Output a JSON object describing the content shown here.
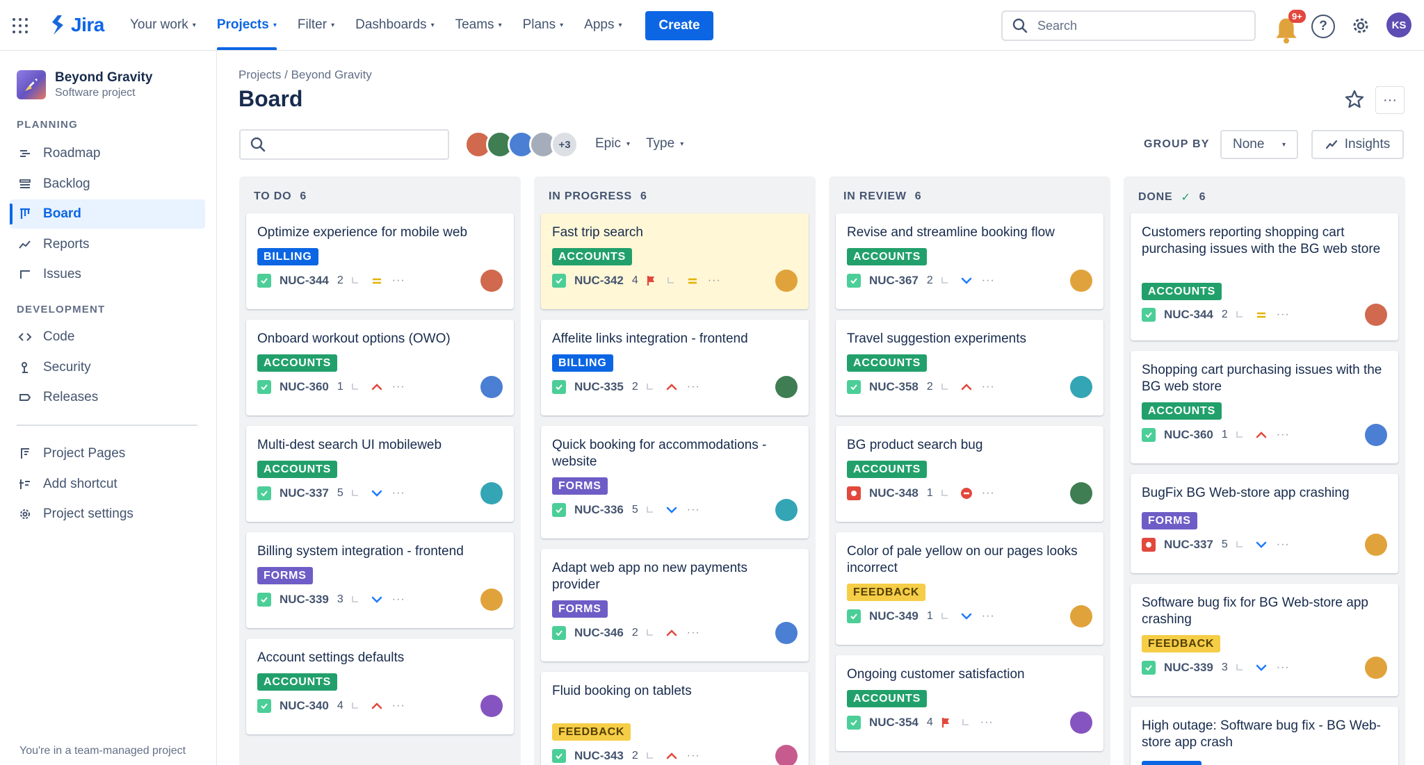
{
  "nav": {
    "logo": "Jira",
    "items": [
      {
        "label": "Your work"
      },
      {
        "label": "Projects",
        "active": true
      },
      {
        "label": "Filter"
      },
      {
        "label": "Dashboards"
      },
      {
        "label": "Teams"
      },
      {
        "label": "Plans"
      },
      {
        "label": "Apps"
      }
    ],
    "create": "Create",
    "search_placeholder": "Search",
    "notifications": "9+",
    "help": "?",
    "user_initials": "KS"
  },
  "sidebar": {
    "project_name": "Beyond Gravity",
    "project_type": "Software project",
    "planning_title": "PLANNING",
    "planning": [
      {
        "label": "Roadmap",
        "icon": "roadmap-icon"
      },
      {
        "label": "Backlog",
        "icon": "backlog-icon"
      },
      {
        "label": "Board",
        "icon": "board-icon",
        "active": true
      },
      {
        "label": "Reports",
        "icon": "reports-icon"
      },
      {
        "label": "Issues",
        "icon": "issues-icon"
      }
    ],
    "development_title": "DEVELOPMENT",
    "development": [
      {
        "label": "Code",
        "icon": "code-icon"
      },
      {
        "label": "Security",
        "icon": "security-icon"
      },
      {
        "label": "Releases",
        "icon": "releases-icon"
      }
    ],
    "extra": [
      {
        "label": "Project Pages",
        "icon": "pages-icon"
      },
      {
        "label": "Add shortcut",
        "icon": "add-shortcut-icon"
      },
      {
        "label": "Project settings",
        "icon": "settings-icon"
      }
    ],
    "footer": "You're in a team-managed project"
  },
  "header": {
    "breadcrumb": "Projects / Beyond Gravity",
    "title": "Board",
    "more": "···"
  },
  "toolbar": {
    "avatars_more": "+3",
    "epic": "Epic",
    "type": "Type",
    "group_by_label": "GROUP BY",
    "group_by_value": "None",
    "insights": "Insights"
  },
  "colors": {
    "accent": "#0c66e4",
    "accounts": "#22a06b",
    "billing": "#0c66e4",
    "forms": "#6e5dc6",
    "feedback": "#f5cd47"
  },
  "columns": [
    {
      "title": "TO DO",
      "count": "6",
      "cards": [
        {
          "title": "Optimize experience for mobile web",
          "label": "BILLING",
          "key": "NUC-344",
          "points": "2",
          "priority": "medium",
          "avatar": "#d0694d"
        },
        {
          "title": "Onboard workout options (OWO)",
          "label": "ACCOUNTS",
          "key": "NUC-360",
          "points": "1",
          "priority": "high",
          "avatar": "#4a7fd4"
        },
        {
          "title": "Multi-dest search UI mobileweb",
          "label": "ACCOUNTS",
          "key": "NUC-337",
          "points": "5",
          "priority": "low",
          "avatar": "#33a5b5"
        },
        {
          "title": "Billing system integration - frontend",
          "label": "FORMS",
          "key": "NUC-339",
          "points": "3",
          "priority": "low",
          "avatar": "#e0a33b"
        },
        {
          "title": "Account settings defaults",
          "label": "ACCOUNTS",
          "key": "NUC-340",
          "points": "4",
          "priority": "high",
          "avatar": "#8654c0"
        }
      ]
    },
    {
      "title": "IN PROGRESS",
      "count": "6",
      "cards": [
        {
          "title": "Fast trip search",
          "label": "ACCOUNTS",
          "key": "NUC-342",
          "points": "4",
          "priority": "medium",
          "flag": true,
          "highlight": true,
          "avatar": "#e0a33b"
        },
        {
          "title": "Affelite links integration - frontend",
          "label": "BILLING",
          "key": "NUC-335",
          "points": "2",
          "priority": "high",
          "avatar": "#3f7d52"
        },
        {
          "title": "Quick booking for accommodations - website",
          "label": "FORMS",
          "key": "NUC-336",
          "points": "5",
          "priority": "low",
          "avatar": "#33a5b5"
        },
        {
          "title": "Adapt web app no new payments provider",
          "label": "FORMS",
          "key": "NUC-346",
          "points": "2",
          "priority": "high",
          "avatar": "#4a7fd4"
        },
        {
          "title": "Fluid booking on tablets",
          "label": "FEEDBACK",
          "key": "NUC-343",
          "points": "2",
          "priority": "high",
          "avatar": "#c85b8e"
        }
      ]
    },
    {
      "title": "IN REVIEW",
      "count": "6",
      "cards": [
        {
          "title": "Revise and streamline booking flow",
          "label": "ACCOUNTS",
          "key": "NUC-367",
          "points": "2",
          "priority": "low",
          "avatar": "#e0a33b"
        },
        {
          "title": "Travel suggestion experiments",
          "label": "ACCOUNTS",
          "key": "NUC-358",
          "points": "2",
          "priority": "high",
          "avatar": "#33a5b5"
        },
        {
          "title": "BG product search bug",
          "label": "ACCOUNTS",
          "key": "NUC-348",
          "points": "1",
          "priority": "blocker",
          "bug": true,
          "avatar": "#3f7d52"
        },
        {
          "title": "Color of pale yellow on our pages looks incorrect",
          "label": "FEEDBACK",
          "key": "NUC-349",
          "points": "1",
          "priority": "low",
          "avatar": "#e0a33b"
        },
        {
          "title": "Ongoing customer satisfaction",
          "label": "ACCOUNTS",
          "key": "NUC-354",
          "points": "4",
          "priority": "none",
          "flag": true,
          "avatar": "#8654c0"
        }
      ]
    },
    {
      "title": "DONE",
      "count": "6",
      "done": true,
      "cards": [
        {
          "title": "Customers reporting shopping cart purchasing issues with the BG web store",
          "label": "ACCOUNTS",
          "key": "NUC-344",
          "points": "2",
          "priority": "medium",
          "avatar": "#d0694d"
        },
        {
          "title": "Shopping cart purchasing issues with the BG web store",
          "label": "ACCOUNTS",
          "key": "NUC-360",
          "points": "1",
          "priority": "high",
          "avatar": "#4a7fd4"
        },
        {
          "title": "BugFix BG Web-store app crashing",
          "label": "FORMS",
          "key": "NUC-337",
          "points": "5",
          "priority": "low",
          "bug": true,
          "avatar": "#e0a33b"
        },
        {
          "title": "Software bug fix for BG Web-store app crashing",
          "label": "FEEDBACK",
          "key": "NUC-339",
          "points": "3",
          "priority": "low",
          "avatar": "#e0a33b"
        },
        {
          "title": "High outage: Software bug fix - BG Web-store app crash",
          "label": "",
          "key": "",
          "points": "",
          "priority": "none",
          "avatar": ""
        }
      ]
    }
  ]
}
